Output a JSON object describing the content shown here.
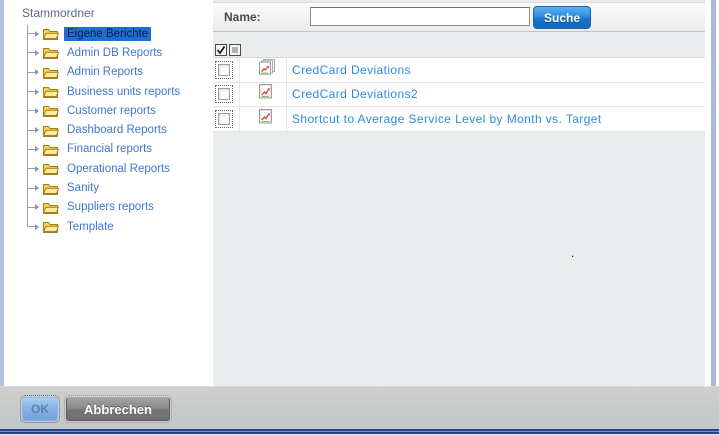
{
  "sidebar": {
    "root_label": "Stammordner",
    "folders": [
      {
        "label": "Eigene Berichte",
        "selected": true
      },
      {
        "label": "Admin DB Reports",
        "selected": false
      },
      {
        "label": "Admin Reports",
        "selected": false
      },
      {
        "label": "Business units reports",
        "selected": false
      },
      {
        "label": "Customer reports",
        "selected": false
      },
      {
        "label": "Dashboard Reports",
        "selected": false
      },
      {
        "label": "Financial reports",
        "selected": false
      },
      {
        "label": "Operational Reports",
        "selected": false
      },
      {
        "label": "Sanity",
        "selected": false
      },
      {
        "label": "Suppliers reports",
        "selected": false
      },
      {
        "label": "Template",
        "selected": false
      }
    ]
  },
  "search_bar": {
    "name_label": "Name:",
    "input_value": "",
    "search_button_label": "Suche"
  },
  "list": {
    "toggle_icons": [
      {
        "name": "select-all-checkbox",
        "state": "checked"
      },
      {
        "name": "clear-all-checkbox",
        "state": "unchecked"
      }
    ],
    "items": [
      {
        "label": "CredCard Deviations",
        "icon": "stacked-report-chart-icon",
        "checked": false
      },
      {
        "label": "CredCard Deviations2",
        "icon": "report-chart-icon",
        "checked": false
      },
      {
        "label": "Shortcut to Average Service Level by Month vs. Target",
        "icon": "report-chart-icon",
        "checked": false
      }
    ],
    "stray_dot": "."
  },
  "footer": {
    "ok_label": "OK",
    "ok_enabled": false,
    "cancel_label": "Abbrechen"
  },
  "colors": {
    "accent_blue": "#1976cf",
    "selection_blue": "#1e6fd0",
    "link_blue": "#2b8be0",
    "tree_link_blue": "#3f77cc",
    "panel_gray": "#e9eded",
    "footer_gray": "#c6caca",
    "window_edge": "#b2bee0",
    "bottom_navy": "#27427f"
  }
}
